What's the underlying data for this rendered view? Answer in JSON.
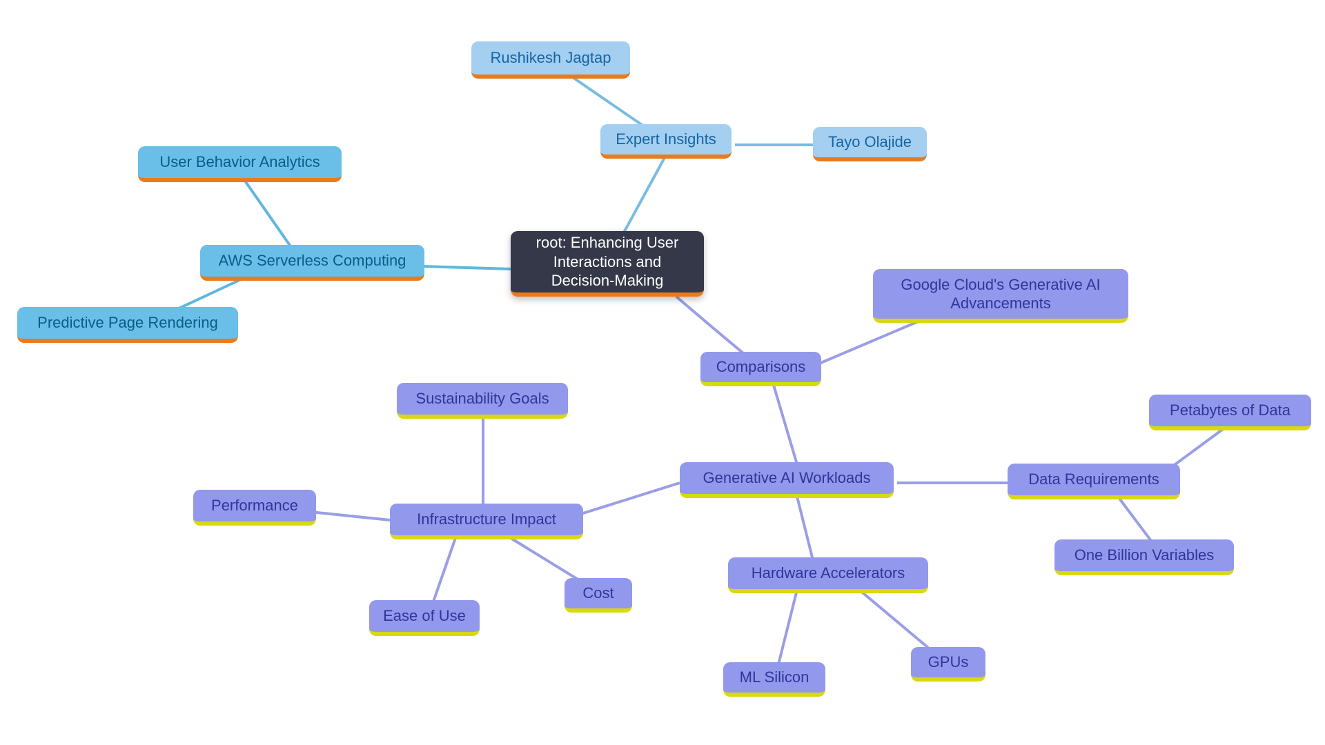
{
  "nodes": {
    "root": "root: Enhancing User Interactions and Decision-Making",
    "expert_insights": "Expert Insights",
    "rushikesh": "Rushikesh Jagtap",
    "tayo": "Tayo Olajide",
    "aws": "AWS Serverless Computing",
    "user_behavior": "User Behavior Analytics",
    "predictive": "Predictive Page Rendering",
    "comparisons": "Comparisons",
    "google": "Google Cloud's Generative AI Advancements",
    "genai": "Generative AI Workloads",
    "infra": "Infrastructure Impact",
    "sustainability": "Sustainability Goals",
    "performance": "Performance",
    "ease": "Ease of Use",
    "cost": "Cost",
    "hardware": "Hardware Accelerators",
    "gpus": "GPUs",
    "mlsilicon": "ML Silicon",
    "datareq": "Data Requirements",
    "petabytes": "Petabytes of Data",
    "billion": "One Billion Variables"
  }
}
